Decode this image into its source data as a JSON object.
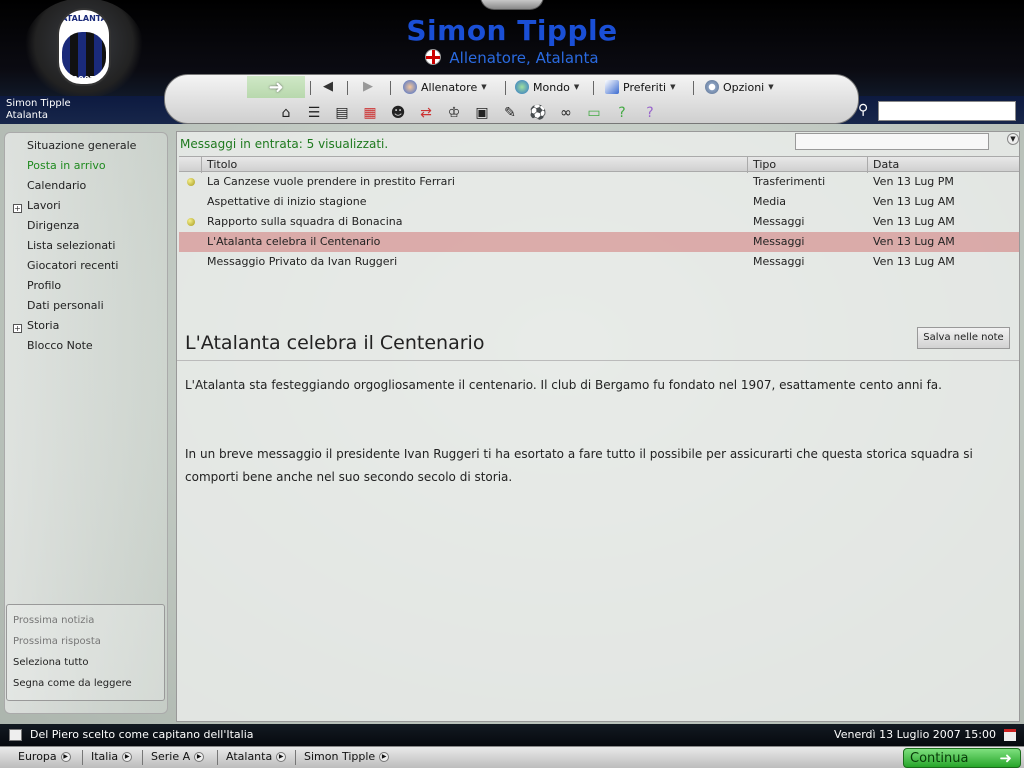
{
  "header": {
    "manager_name": "Simon Tipple",
    "subtitle": "Allenatore, Atalanta",
    "crest_name": "ATALANTA",
    "crest_year": "1907"
  },
  "profile": {
    "line1": "Simon Tipple",
    "line2": "Atalanta"
  },
  "toolbar": {
    "go_icon": "right-arrow-icon",
    "menus": [
      {
        "label": "Allenatore",
        "icon": "manager-icon"
      },
      {
        "label": "Mondo",
        "icon": "globe-icon"
      },
      {
        "label": "Preferiti",
        "icon": "bookmark-icon"
      },
      {
        "label": "Opzioni",
        "icon": "gear-icon"
      }
    ],
    "icons": [
      "home-icon",
      "news-icon",
      "book-icon",
      "calendar-icon",
      "squad-icon",
      "transfer-icon",
      "trophy-icon",
      "tactics-icon",
      "notes-icon",
      "training-icon",
      "scouting-icon",
      "finances-icon",
      "help-icon",
      "info-icon"
    ]
  },
  "search": {
    "placeholder": ""
  },
  "sidebar": {
    "items": [
      {
        "label": "Situazione generale",
        "expandable": false,
        "active": false
      },
      {
        "label": "Posta in arrivo",
        "expandable": false,
        "active": true
      },
      {
        "label": "Calendario",
        "expandable": false,
        "active": false
      },
      {
        "label": "Lavori",
        "expandable": true,
        "active": false
      },
      {
        "label": "Dirigenza",
        "expandable": false,
        "active": false
      },
      {
        "label": "Lista selezionati",
        "expandable": false,
        "active": false
      },
      {
        "label": "Giocatori recenti",
        "expandable": false,
        "active": false
      },
      {
        "label": "Profilo",
        "expandable": false,
        "active": false
      },
      {
        "label": "Dati personali",
        "expandable": false,
        "active": false
      },
      {
        "label": "Storia",
        "expandable": true,
        "active": false
      },
      {
        "label": "Blocco Note",
        "expandable": false,
        "active": false
      }
    ],
    "actions": [
      {
        "label": "Prossima notizia",
        "enabled": false
      },
      {
        "label": "Prossima risposta",
        "enabled": false
      },
      {
        "label": "Seleziona tutto",
        "enabled": true
      },
      {
        "label": "Segna come da leggere",
        "enabled": true
      }
    ]
  },
  "inbox": {
    "summary": "Messaggi in entrata: 5 visualizzati.",
    "columns": {
      "title": "Titolo",
      "type": "Tipo",
      "date": "Data"
    },
    "messages": [
      {
        "title": "La Canzese vuole prendere in prestito Ferrari",
        "type": "Trasferimenti",
        "date": "Ven 13 Lug PM",
        "unread": true,
        "selected": false
      },
      {
        "title": "Aspettative di inizio stagione",
        "type": "Media",
        "date": "Ven 13 Lug AM",
        "unread": false,
        "selected": false
      },
      {
        "title": "Rapporto sulla squadra di Bonacina",
        "type": "Messaggi",
        "date": "Ven 13 Lug AM",
        "unread": true,
        "selected": false
      },
      {
        "title": "L'Atalanta celebra il Centenario",
        "type": "Messaggi",
        "date": "Ven 13 Lug AM",
        "unread": false,
        "selected": true
      },
      {
        "title": "Messaggio Privato da Ivan Ruggeri",
        "type": "Messaggi",
        "date": "Ven 13 Lug AM",
        "unread": false,
        "selected": false
      }
    ]
  },
  "detail": {
    "title": "L'Atalanta celebra il Centenario",
    "save_label": "Salva nelle note",
    "paragraphs": [
      "L'Atalanta sta festeggiando orgogliosamente il centenario. Il club di Bergamo fu fondato nel 1907, esattamente cento anni fa.",
      "In un breve messaggio il presidente Ivan Ruggeri ti ha esortato a fare tutto il possibile per assicurarti che questa storica squadra si comporti bene anche nel suo secondo secolo di storia."
    ]
  },
  "status": {
    "news": "Del Piero scelto come capitano dell'Italia",
    "datetime": "Venerdì 13 Luglio 2007 15:00"
  },
  "breadcrumb": [
    "Europa",
    "Italia",
    "Serie A",
    "Atalanta",
    "Simon Tipple"
  ],
  "continue_label": "Continua",
  "colors": {
    "accent_blue": "#1a4fd6",
    "active_green": "#1f8a1f",
    "selected_row": "#d27878",
    "continue_green": "#27a52a"
  }
}
